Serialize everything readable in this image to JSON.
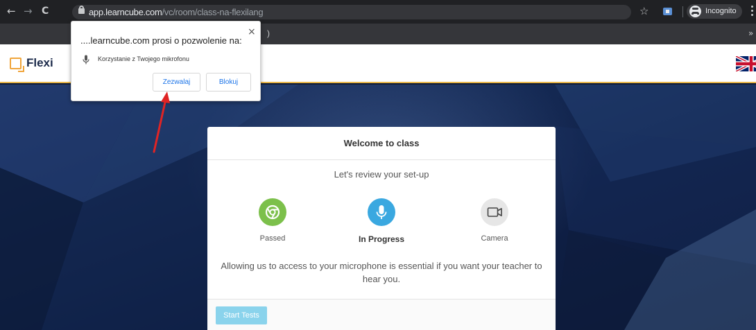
{
  "browser": {
    "url_host": "app.learncube.com",
    "url_path": "/vc/room/class-na-flexilang",
    "incognito_label": "Incognito",
    "nav_back": "←",
    "nav_forward": "→",
    "nav_reload": "C",
    "star_glyph": "☆",
    "bookmarks_more": "»",
    "fragment": ")"
  },
  "site": {
    "logo_text": "Flexi",
    "flag_icon": "uk-flag-icon"
  },
  "permission_popup": {
    "title": "....learncube.com prosi o pozwolenie na:",
    "permission_text": "Korzystanie z Twojego mikrofonu",
    "allow_label": "Zezwalaj",
    "block_label": "Blokuj",
    "close_glyph": "×"
  },
  "card": {
    "title": "Welcome to class",
    "subtitle": "Let's review your set-up",
    "steps": [
      {
        "label": "Passed",
        "icon": "chrome-icon",
        "color": "#7cc04b"
      },
      {
        "label": "In Progress",
        "icon": "microphone-icon",
        "color": "#3aa8e0"
      },
      {
        "label": "Camera",
        "icon": "video-camera-icon",
        "color": "#e6e6e6"
      }
    ],
    "message": "Allowing us to access to your microphone is essential if you want your teacher to hear you.",
    "start_button": "Start Tests"
  },
  "colors": {
    "accent_orange": "#e8b64a",
    "button_blue": "#8ad3ec",
    "annotation_arrow": "#e02424"
  }
}
